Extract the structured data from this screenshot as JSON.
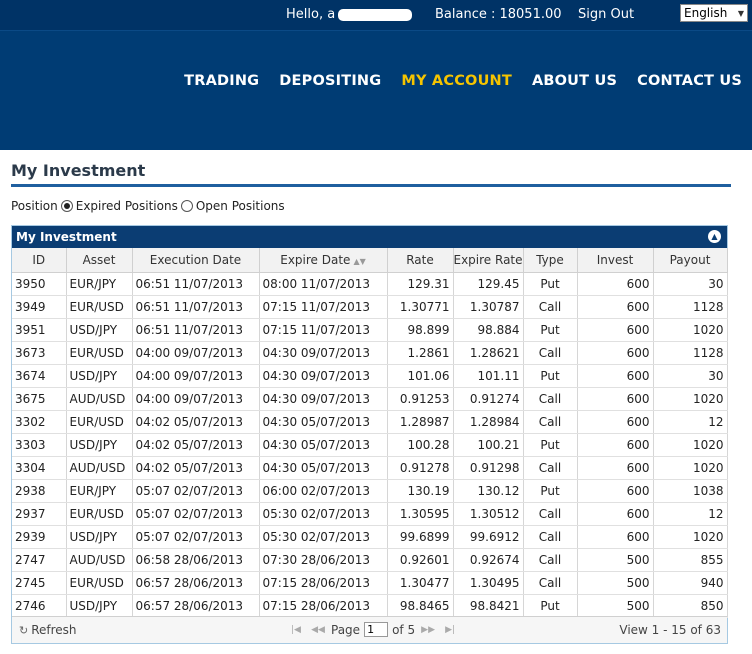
{
  "topbar": {
    "hello": "Hello, a",
    "balance": "Balance : 18051.00",
    "signout": "Sign Out",
    "language": "English"
  },
  "nav": {
    "items": [
      "TRADING",
      "DEPOSITING",
      "MY ACCOUNT",
      "ABOUT US",
      "CONTACT US"
    ],
    "active": "MY ACCOUNT",
    "active_color": "#f5c400"
  },
  "page": {
    "title": "My Investment"
  },
  "filters": {
    "label": "Position",
    "expired": "Expired Positions",
    "open": "Open Positions",
    "selected": "Expired Positions"
  },
  "grid": {
    "caption": "My Investment",
    "columns": [
      "ID",
      "Asset",
      "Execution Date",
      "Expire Date",
      "Rate",
      "Expire Rate",
      "Type",
      "Invest",
      "Payout"
    ],
    "rows": [
      [
        "3950",
        "EUR/JPY",
        "06:51 11/07/2013",
        "08:00 11/07/2013",
        "129.31",
        "129.45",
        "Put",
        "600",
        "30"
      ],
      [
        "3949",
        "EUR/USD",
        "06:51 11/07/2013",
        "07:15 11/07/2013",
        "1.30771",
        "1.30787",
        "Call",
        "600",
        "1128"
      ],
      [
        "3951",
        "USD/JPY",
        "06:51 11/07/2013",
        "07:15 11/07/2013",
        "98.899",
        "98.884",
        "Put",
        "600",
        "1020"
      ],
      [
        "3673",
        "EUR/USD",
        "04:00 09/07/2013",
        "04:30 09/07/2013",
        "1.2861",
        "1.28621",
        "Call",
        "600",
        "1128"
      ],
      [
        "3674",
        "USD/JPY",
        "04:00 09/07/2013",
        "04:30 09/07/2013",
        "101.06",
        "101.11",
        "Put",
        "600",
        "30"
      ],
      [
        "3675",
        "AUD/USD",
        "04:00 09/07/2013",
        "04:30 09/07/2013",
        "0.91253",
        "0.91274",
        "Call",
        "600",
        "1020"
      ],
      [
        "3302",
        "EUR/USD",
        "04:02 05/07/2013",
        "04:30 05/07/2013",
        "1.28987",
        "1.28984",
        "Call",
        "600",
        "12"
      ],
      [
        "3303",
        "USD/JPY",
        "04:02 05/07/2013",
        "04:30 05/07/2013",
        "100.28",
        "100.21",
        "Put",
        "600",
        "1020"
      ],
      [
        "3304",
        "AUD/USD",
        "04:02 05/07/2013",
        "04:30 05/07/2013",
        "0.91278",
        "0.91298",
        "Call",
        "600",
        "1020"
      ],
      [
        "2938",
        "EUR/JPY",
        "05:07 02/07/2013",
        "06:00 02/07/2013",
        "130.19",
        "130.12",
        "Put",
        "600",
        "1038"
      ],
      [
        "2937",
        "EUR/USD",
        "05:07 02/07/2013",
        "05:30 02/07/2013",
        "1.30595",
        "1.30512",
        "Call",
        "600",
        "12"
      ],
      [
        "2939",
        "USD/JPY",
        "05:07 02/07/2013",
        "05:30 02/07/2013",
        "99.6899",
        "99.6912",
        "Call",
        "600",
        "1020"
      ],
      [
        "2747",
        "AUD/USD",
        "06:58 28/06/2013",
        "07:30 28/06/2013",
        "0.92601",
        "0.92674",
        "Call",
        "500",
        "855"
      ],
      [
        "2745",
        "EUR/USD",
        "06:57 28/06/2013",
        "07:15 28/06/2013",
        "1.30477",
        "1.30495",
        "Call",
        "500",
        "940"
      ],
      [
        "2746",
        "USD/JPY",
        "06:57 28/06/2013",
        "07:15 28/06/2013",
        "98.8465",
        "98.8421",
        "Put",
        "500",
        "850"
      ]
    ]
  },
  "pager": {
    "refresh": "Refresh",
    "page_label": "Page",
    "page_value": "1",
    "of_label": "of 5",
    "view": "View 1 - 15 of 63"
  },
  "colors": {
    "topbar": "#003366",
    "header": "#003c74",
    "caption": "#0b3d73",
    "rule": "#1f5f9f"
  }
}
